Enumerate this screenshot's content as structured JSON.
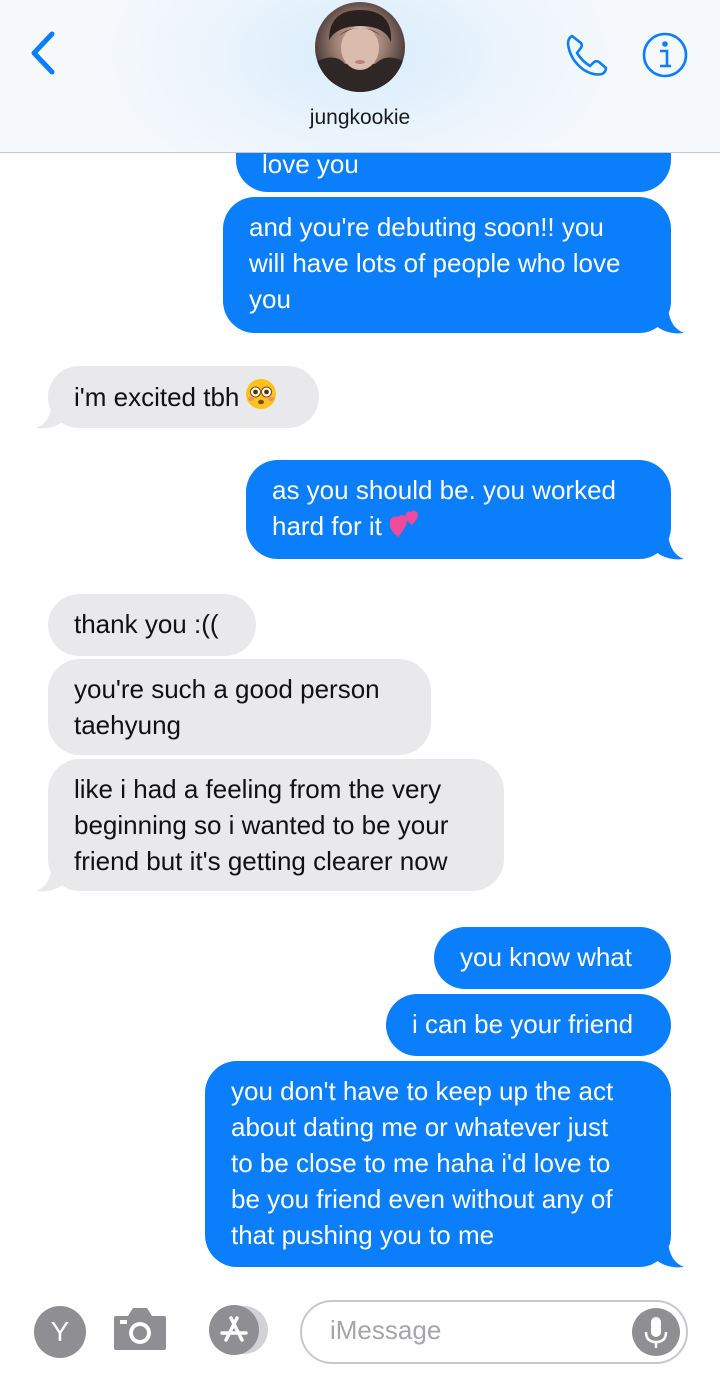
{
  "header": {
    "contact_name": "jungkookie",
    "icons": {
      "back": "chevron-left-icon",
      "call": "phone-icon",
      "info": "info-icon"
    },
    "accent_color": "#0b7efb"
  },
  "messages": [
    {
      "direction": "outgoing",
      "text": "love you",
      "partial": true
    },
    {
      "direction": "outgoing",
      "lines": [
        "and you're debuting soon!! you",
        "will have lots of people who love",
        "you"
      ]
    },
    {
      "direction": "incoming",
      "text": "i'm excited tbh",
      "emoji": "flushed-face"
    },
    {
      "direction": "outgoing",
      "lines": [
        "as you should be. you worked",
        "hard for it"
      ],
      "emoji": "two-hearts"
    },
    {
      "direction": "incoming",
      "text": "thank you :(("
    },
    {
      "direction": "incoming",
      "lines": [
        "you're such a good person",
        "taehyung"
      ]
    },
    {
      "direction": "incoming",
      "lines": [
        "like i had a feeling from the very",
        "beginning so i wanted to be your",
        "friend but it's getting clearer now"
      ]
    },
    {
      "direction": "outgoing",
      "text": "you know what"
    },
    {
      "direction": "outgoing",
      "text": "i can be your friend"
    },
    {
      "direction": "outgoing",
      "lines": [
        "you don't have to keep up the act",
        "about dating me or whatever just",
        "to be close to me haha i'd love to",
        "be you friend even without any of",
        "that pushing you to me"
      ]
    }
  ],
  "input_bar": {
    "apps_label": "Y",
    "placeholder": "iMessage",
    "icons": {
      "camera": "camera-icon",
      "appstore": "app-store-icon",
      "mic": "microphone-icon"
    }
  }
}
